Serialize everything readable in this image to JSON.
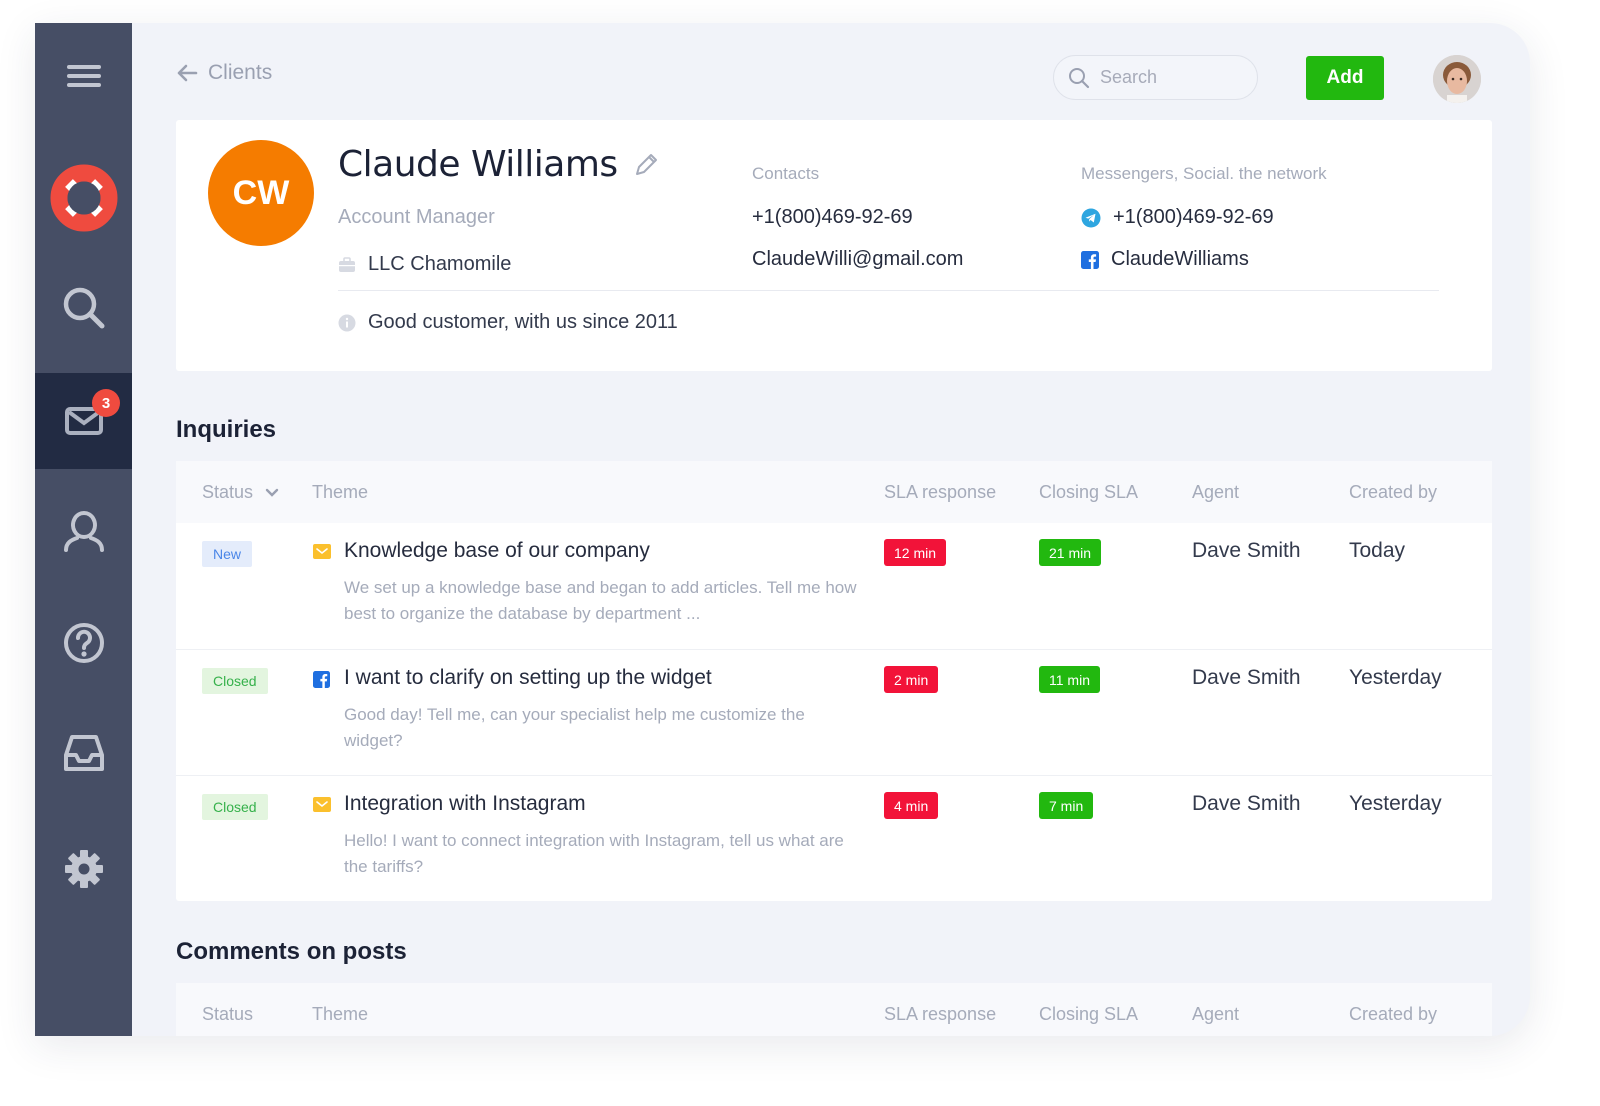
{
  "sidebar": {
    "items": [
      {
        "name": "menu",
        "icon": "hamburger-menu-icon"
      },
      {
        "name": "support",
        "icon": "lifebuoy-icon"
      },
      {
        "name": "search",
        "icon": "search-icon"
      },
      {
        "name": "inbox-messages",
        "icon": "envelope-icon",
        "badge": "3",
        "active": true
      },
      {
        "name": "clients",
        "icon": "user-icon"
      },
      {
        "name": "help",
        "icon": "question-circle-icon"
      },
      {
        "name": "archive",
        "icon": "tray-icon"
      },
      {
        "name": "settings",
        "icon": "gear-icon"
      }
    ]
  },
  "header": {
    "back_label": "Clients",
    "search_placeholder": "Search",
    "add_label": "Add"
  },
  "profile": {
    "initials": "CW",
    "name": "Claude Williams",
    "role": "Account Manager",
    "company": "LLC Chamomile",
    "note": "Good customer, with us since 2011",
    "contacts_heading": "Contacts",
    "phone": "+1(800)469-92-69",
    "email": "ClaudeWilli@gmail.com",
    "messengers_heading": "Messengers, Social. the network",
    "telegram": "+1(800)469-92-69",
    "facebook": "ClaudeWilliams",
    "colors": {
      "avatar": "#f57c00",
      "telegram": "#2ea6e0",
      "facebook": "#1f6fe0"
    }
  },
  "inquiries": {
    "title": "Inquiries",
    "columns": {
      "status": "Status",
      "theme": "Theme",
      "sla_response": "SLA response",
      "closing_sla": "Closing SLA",
      "agent": "Agent",
      "created_by": "Created by"
    },
    "rows": [
      {
        "status": "New",
        "channel": "email",
        "title": "Knowledge base of our company",
        "description": "We set up a knowledge base and began to add articles. Tell me how best to organize the database by department ...",
        "sla_response": "12 min",
        "closing_sla": "21 min",
        "agent": "Dave Smith",
        "created": "Today"
      },
      {
        "status": "Closed",
        "channel": "facebook",
        "title": "I want to clarify on setting up the widget",
        "description": "Good day! Tell me, can your specialist help me customize the widget?",
        "sla_response": "2 min",
        "closing_sla": "11 min",
        "agent": "Dave Smith",
        "created": "Yesterday"
      },
      {
        "status": "Closed",
        "channel": "email",
        "title": "Integration with Instagram",
        "description": "Hello! I want to connect integration with Instagram, tell us what are the tariffs?",
        "sla_response": "4 min",
        "closing_sla": "7 min",
        "agent": "Dave Smith",
        "created": "Yesterday"
      }
    ]
  },
  "comments": {
    "title": "Comments on posts",
    "columns": {
      "status": "Status",
      "theme": "Theme",
      "sla_response": "SLA response",
      "closing_sla": "Closing SLA",
      "agent": "Agent",
      "created_by": "Created by"
    }
  },
  "colors": {
    "sidebar": "#464e65",
    "sidebar_active": "#222b43",
    "accent_green": "#22b80f",
    "sla_red": "#f21339",
    "badge_red": "#ef4b3f"
  }
}
